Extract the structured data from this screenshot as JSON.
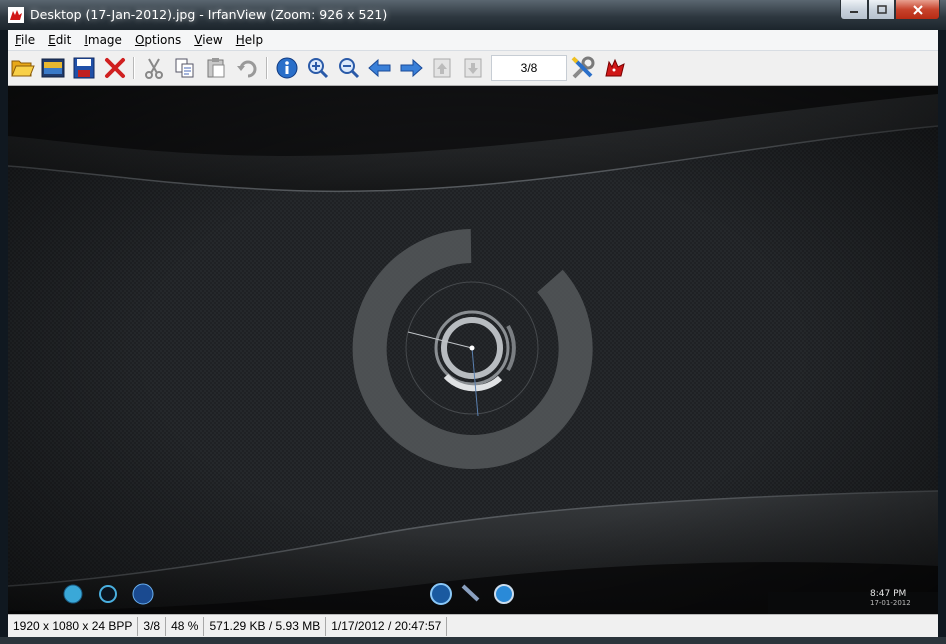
{
  "window": {
    "title": "Desktop (17-Jan-2012).jpg - IrfanView (Zoom: 926 x 521)",
    "app_icon": "irfanview-cat-icon"
  },
  "menu": [
    {
      "mnemonic": "F",
      "rest": "ile"
    },
    {
      "mnemonic": "E",
      "rest": "dit"
    },
    {
      "mnemonic": "I",
      "rest": "mage"
    },
    {
      "mnemonic": "O",
      "rest": "ptions"
    },
    {
      "mnemonic": "V",
      "rest": "iew"
    },
    {
      "mnemonic": "H",
      "rest": "elp"
    }
  ],
  "toolbar": {
    "page_indicator": "3/8",
    "icons": [
      "open-folder-icon",
      "slideshow-icon",
      "save-icon",
      "delete-icon",
      "cut-icon",
      "copy-icon",
      "paste-icon",
      "undo-icon",
      "info-icon",
      "zoom-in-icon",
      "zoom-out-icon",
      "previous-arrow-icon",
      "next-arrow-icon",
      "first-page-icon",
      "last-page-icon",
      "properties-tools-icon",
      "irfanview-about-icon"
    ]
  },
  "image_overlay": {
    "clock_time": "8:47 PM",
    "clock_date": "17-01-2012"
  },
  "status": {
    "dimensions": "1920 x 1080 x 24 BPP",
    "index": "3/8",
    "zoom": "48 %",
    "filesize": "571.29 KB / 5.93 MB",
    "datetime": "1/17/2012 / 20:47:57"
  },
  "colors": {
    "accent_blue": "#2a6fc9",
    "close_red": "#c7432c",
    "image_bg": "#1a1c1e"
  }
}
